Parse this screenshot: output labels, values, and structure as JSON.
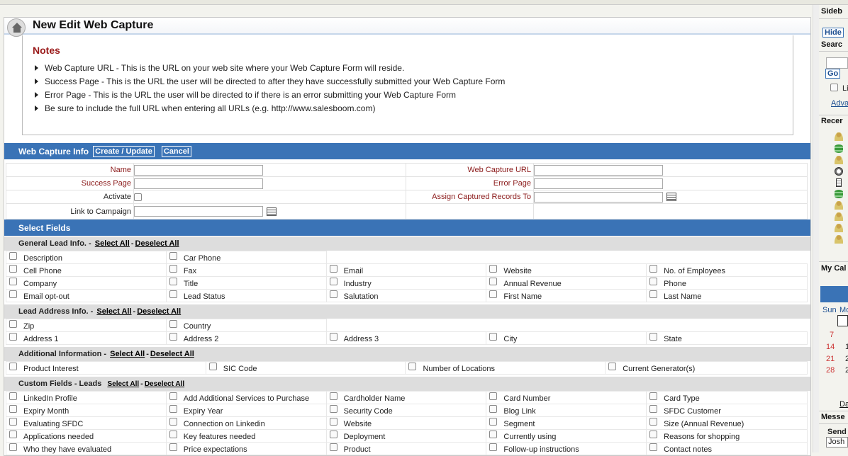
{
  "page": {
    "title": "New Edit Web Capture"
  },
  "notes": {
    "title": "Notes",
    "items": [
      "Web Capture URL - This is the URL on your web site where your Web Capture Form will reside.",
      "Success Page - This is the URL the user will be directed to after they have successfully submitted your Web Capture Form",
      "Error Page - This is the URL the user will be directed to if there is an error submitting your Web Capture Form",
      "Be sure to include the full URL when entering all URLs (e.g. http://www.salesboom.com)"
    ]
  },
  "info": {
    "title": "Web Capture Info",
    "create_label": "Create / Update",
    "cancel_label": "Cancel",
    "name_label": "Name",
    "success_label": "Success Page",
    "activate_label": "Activate",
    "campaign_label": "Link to Campaign",
    "url_label": "Web Capture URL",
    "error_label": "Error Page",
    "assign_label": "Assign Captured Records To"
  },
  "select_fields": {
    "title": "Select Fields",
    "select_all": "Select All",
    "deselect_all": "Deselect All",
    "groups": [
      {
        "title": "General Lead Info.",
        "rows": [
          [
            "Description",
            "Car Phone"
          ],
          [
            "Cell Phone",
            "Fax",
            "Email",
            "Website",
            "No. of Employees"
          ],
          [
            "Company",
            "Title",
            "Industry",
            "Annual Revenue",
            "Phone"
          ],
          [
            "Email opt-out",
            "Lead Status",
            "Salutation",
            "First Name",
            "Last Name"
          ]
        ]
      },
      {
        "title": "Lead Address Info.",
        "rows": [
          [
            "Zip",
            "Country"
          ],
          [
            "Address 1",
            "Address 2",
            "Address 3",
            "City",
            "State"
          ]
        ]
      },
      {
        "title": "Additional Information",
        "rows": [
          [
            "Product Interest",
            "SIC Code",
            "Number of Locations",
            "Current Generator(s)"
          ]
        ]
      },
      {
        "title": "Custom Fields - Leads",
        "rows": [
          [
            "LinkedIn Profile",
            "Add Additional Services to Purchase",
            "Cardholder Name",
            "Card Number",
            "Card Type"
          ],
          [
            "Expiry Month",
            "Expiry Year",
            "Security Code",
            "Blog Link",
            "SFDC Customer"
          ],
          [
            "Evaluating SFDC",
            "Connection on Linkedin",
            "Website",
            "Segment",
            "Size (Annual Revenue)"
          ],
          [
            "Applications needed",
            "Key features needed",
            "Deployment",
            "Currently using",
            "Reasons for shopping"
          ],
          [
            "Who they have evaluated",
            "Price expectations",
            "Product",
            "Follow-up instructions",
            "Contact notes"
          ]
        ]
      }
    ]
  },
  "sidebar": {
    "header": "Sideb",
    "hide_label": "Hide",
    "search_label": "Searc",
    "go_label": "Go",
    "limit_label": "Li",
    "advanced_label": "Adva",
    "recent_label": "Recer",
    "calendar_label": "My Cal",
    "cal_days_header": [
      "Sun",
      "Mo"
    ],
    "cal_days": [
      "7",
      "14",
      "21",
      "28"
    ],
    "cal_days_mon": [
      "1",
      "2",
      "2"
    ],
    "date_link": "Da",
    "messages_label": "Messe",
    "send_label": "Send",
    "send_to_value": "Josh"
  }
}
